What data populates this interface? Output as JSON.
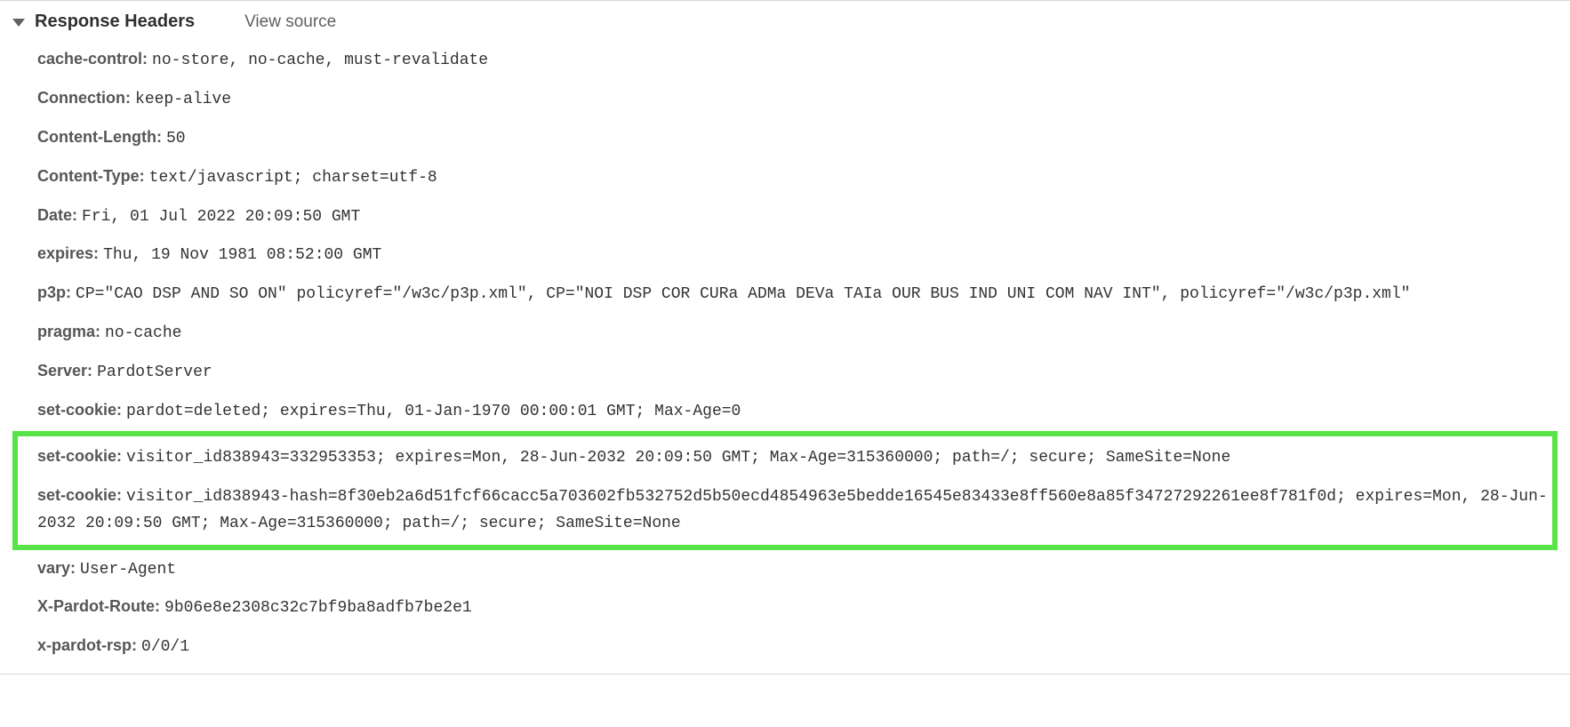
{
  "section": {
    "title": "Response Headers",
    "viewSource": "View source"
  },
  "headers": {
    "cacheControl": {
      "name": "cache-control:",
      "value": "no-store, no-cache, must-revalidate"
    },
    "connection": {
      "name": "Connection:",
      "value": "keep-alive"
    },
    "contentLength": {
      "name": "Content-Length:",
      "value": "50"
    },
    "contentType": {
      "name": "Content-Type:",
      "value": "text/javascript; charset=utf-8"
    },
    "date": {
      "name": "Date:",
      "value": "Fri, 01 Jul 2022 20:09:50 GMT"
    },
    "expires": {
      "name": "expires:",
      "value": "Thu, 19 Nov 1981 08:52:00 GMT"
    },
    "p3p": {
      "name": "p3p:",
      "value": "CP=\"CAO DSP AND SO ON\" policyref=\"/w3c/p3p.xml\", CP=\"NOI DSP COR CURa ADMa DEVa TAIa OUR BUS IND UNI COM NAV INT\", policyref=\"/w3c/p3p.xml\""
    },
    "pragma": {
      "name": "pragma:",
      "value": "no-cache"
    },
    "server": {
      "name": "Server:",
      "value": "PardotServer"
    },
    "setCookie1": {
      "name": "set-cookie:",
      "value": "pardot=deleted; expires=Thu, 01-Jan-1970 00:00:01 GMT; Max-Age=0"
    },
    "setCookie2": {
      "name": "set-cookie:",
      "value": "visitor_id838943=332953353; expires=Mon, 28-Jun-2032 20:09:50 GMT; Max-Age=315360000; path=/; secure; SameSite=None"
    },
    "setCookie3": {
      "name": "set-cookie:",
      "value": "visitor_id838943-hash=8f30eb2a6d51fcf66cacc5a703602fb532752d5b50ecd4854963e5bedde16545e83433e8ff560e8a85f34727292261ee8f781f0d; expires=Mon, 28-Jun-2032 20:09:50 GMT; Max-Age=315360000; path=/; secure; SameSite=None"
    },
    "vary": {
      "name": "vary:",
      "value": "User-Agent"
    },
    "xPardotRoute": {
      "name": "X-Pardot-Route:",
      "value": "9b06e8e2308c32c7bf9ba8adfb7be2e1"
    },
    "xPardotRsp": {
      "name": "x-pardot-rsp:",
      "value": "0/0/1"
    }
  }
}
